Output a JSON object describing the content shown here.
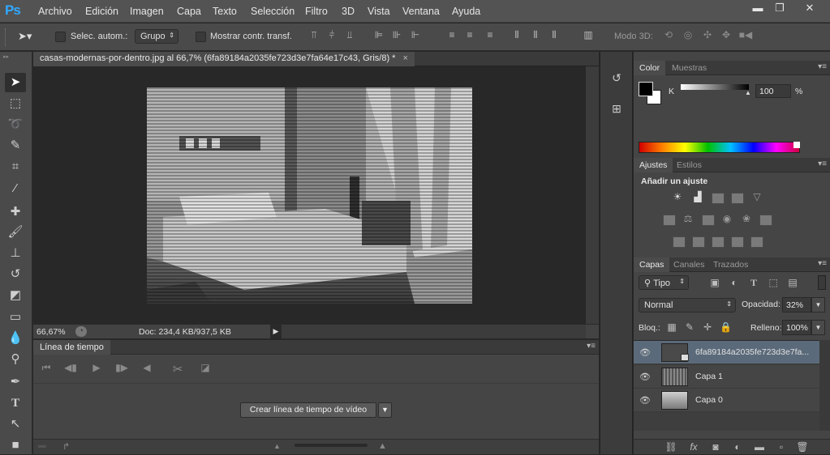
{
  "app": {
    "logo": "Ps"
  },
  "menu": [
    "Archivo",
    "Edición",
    "Imagen",
    "Capa",
    "Texto",
    "Selección",
    "Filtro",
    "3D",
    "Vista",
    "Ventana",
    "Ayuda"
  ],
  "window_controls": {
    "minimize": "▬",
    "restore": "❐",
    "close": "✕"
  },
  "options": {
    "auto_select_label": "Selec. autom.:",
    "group_select": "Grupo",
    "show_transform_label": "Mostrar contr. transf.",
    "mode3d_label": "Modo 3D:"
  },
  "document": {
    "tab_title": "casas-modernas-por-dentro.jpg al 66,7% (6fa89184a2035fe723d3e7fa64e17c43, Gris/8) *",
    "zoom": "66,67%",
    "doc_info": "Doc: 234,4 KB/937,5 KB"
  },
  "timeline": {
    "tab_label": "Línea de tiempo",
    "create_button": "Crear línea de tiempo de vídeo"
  },
  "color_panel": {
    "tabs": [
      "Color",
      "Muestras"
    ],
    "channel": "K",
    "value": "100",
    "unit": "%"
  },
  "adjustments_panel": {
    "tabs": [
      "Ajustes",
      "Estilos"
    ],
    "heading": "Añadir un ajuste"
  },
  "layers_panel": {
    "tabs": [
      "Capas",
      "Canales",
      "Trazados"
    ],
    "filter": "Tipo",
    "blend_mode": "Normal",
    "opacity_label": "Opacidad:",
    "opacity": "32%",
    "lock_label": "Bloq.:",
    "fill_label": "Relleno:",
    "fill": "100%",
    "layers": [
      {
        "name": "6fa89184a2035fe723d3e7fa...",
        "selected": true
      },
      {
        "name": "Capa 1",
        "selected": false
      },
      {
        "name": "Capa 0",
        "selected": false
      }
    ]
  },
  "colors": {
    "accent": "#31a8ff",
    "selected_layer": "#5b6a7a"
  }
}
